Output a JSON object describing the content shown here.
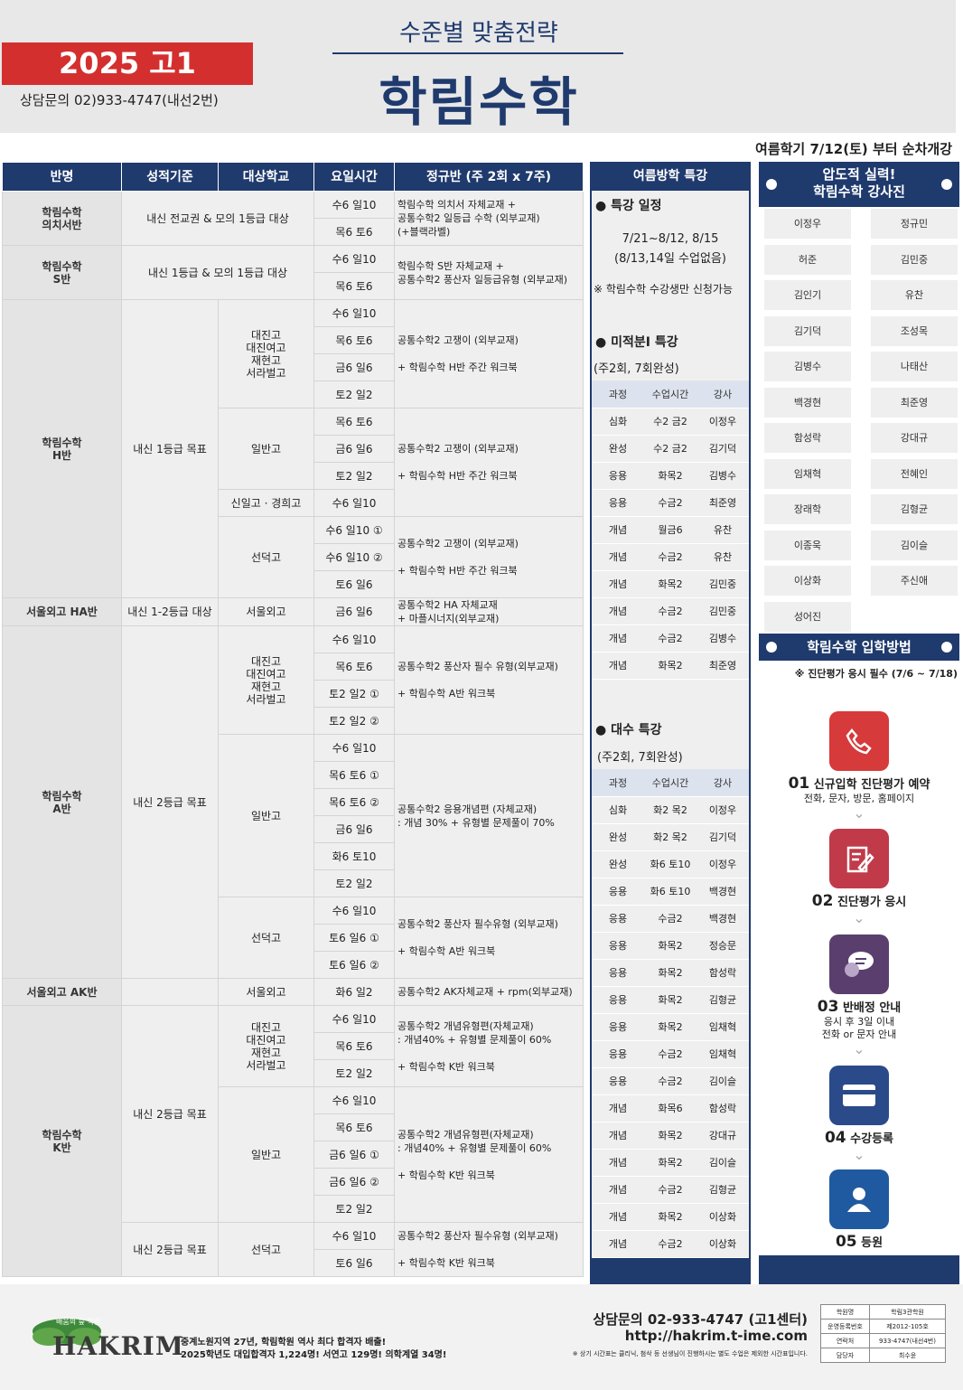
{
  "header": {
    "year": "2025 고1",
    "phone": "상담문의 02)933-4747(내선2번)",
    "subtitle": "수준별 맞춤전략",
    "title": "학림수학",
    "open": "여름학기 7/12(토) 부터 순차개강"
  },
  "cols": [
    "반명",
    "성적기준",
    "대상학교",
    "요일시간",
    "정규반 (주 2회 x 7주)"
  ],
  "rows": [
    [
      "학림수학\n의치서반",
      "내신 전교권 & 모의 1등급 대상",
      "",
      "수6 일10",
      "학림수학 의치서 자체교재 +\n공통수학2 일등급 수학 (외부교재)\n(+블랙라벨)"
    ],
    [
      "",
      "",
      "",
      "목6 토6",
      ""
    ],
    [
      "학림수학\nS반",
      "내신 1등급 & 모의 1등급 대상",
      "",
      "수6 일10",
      "학림수학 S반 자체교재 +\n공통수학2 풍산자 일등급유형 (외부교재)"
    ],
    [
      "",
      "",
      "",
      "목6 토6",
      ""
    ],
    [
      "학림수학\nH반",
      "내신 1등급 목표",
      "대진고\n대진여고\n재현고\n서라벌고",
      "수6 일10",
      "공통수학2 고쟁이 (외부교재)\n\n+ 학림수학 H반 주간 워크북"
    ],
    [
      "",
      "",
      "",
      "목6 토6",
      ""
    ],
    [
      "",
      "",
      "",
      "금6 일6",
      ""
    ],
    [
      "",
      "",
      "",
      "토2 일2",
      ""
    ],
    [
      "",
      "",
      "일반고",
      "목6 토6",
      "공통수학2 고쟁이 (외부교재)\n\n+ 학림수학 H반 주간 워크북"
    ],
    [
      "",
      "",
      "",
      "금6 일6",
      ""
    ],
    [
      "",
      "",
      "",
      "토2 일2",
      ""
    ],
    [
      "",
      "",
      "신일고 · 경희고",
      "수6 일10",
      ""
    ],
    [
      "",
      "",
      "선덕고",
      "수6 일10 ①",
      "공통수학2 고쟁이 (외부교재)\n\n+ 학림수학 H반 주간 워크북"
    ],
    [
      "",
      "",
      "",
      "수6 일10 ②",
      ""
    ],
    [
      "",
      "",
      "",
      "토6 일6",
      ""
    ],
    [
      "서울외고 HA반",
      "내신 1-2등급 대상",
      "서울외고",
      "금6 일6",
      "공통수학2 HA 자체교재\n+ 마플시너지(외부교재)"
    ],
    [
      "학림수학\nA반",
      "내신 2등급 목표",
      "대진고\n대진여고\n재현고\n서라벌고",
      "수6 일10",
      "공통수학2 풍산자 필수 유형(외부교재)\n\n+ 학림수학 A반 워크북"
    ],
    [
      "",
      "",
      "",
      "목6 토6",
      ""
    ],
    [
      "",
      "",
      "",
      "토2 일2 ①",
      ""
    ],
    [
      "",
      "",
      "",
      "토2 일2 ②",
      ""
    ],
    [
      "",
      "",
      "일반고",
      "수6 일10",
      "공통수학2 응용개념편 (자체교재)\n: 개념 30% + 유형별 문제풀이 70%"
    ],
    [
      "",
      "",
      "",
      "목6 토6 ①",
      ""
    ],
    [
      "",
      "",
      "",
      "목6 토6 ②",
      ""
    ],
    [
      "",
      "",
      "",
      "금6 일6",
      ""
    ],
    [
      "",
      "",
      "",
      "화6 토10",
      ""
    ],
    [
      "",
      "",
      "",
      "토2 일2",
      ""
    ],
    [
      "",
      "",
      "선덕고",
      "수6 일10",
      "공통수학2 풍산자 필수유형 (외부교재)\n\n+ 학림수학 A반 워크북"
    ],
    [
      "",
      "",
      "",
      "토6 일6 ①",
      ""
    ],
    [
      "",
      "",
      "",
      "토6 일6 ②",
      ""
    ],
    [
      "서울외고 AK반",
      "",
      "서울외고",
      "화6 일2",
      "공통수학2 AK자체교재 + rpm(외부교재)"
    ],
    [
      "학림수학\nK반",
      "내신 2등급 목표",
      "대진고\n대진여고\n재현고\n서라벌고",
      "수6 일10",
      "공통수학2 개념유형편(자체교재)\n: 개념40% + 유형별 문제풀이 60%\n\n+ 학림수학 K반 워크북"
    ],
    [
      "",
      "",
      "",
      "목6 토6",
      ""
    ],
    [
      "",
      "",
      "",
      "토2 일2",
      ""
    ],
    [
      "",
      "",
      "일반고",
      "수6 일10",
      "공통수학2 개념유형편(자체교재)\n: 개념40% + 유형별 문제풀이 60%\n\n+ 학림수학 K반 워크북"
    ],
    [
      "",
      "",
      "",
      "목6 토6",
      ""
    ],
    [
      "",
      "",
      "",
      "금6 일6 ①",
      ""
    ],
    [
      "",
      "",
      "",
      "금6 일6 ②",
      ""
    ],
    [
      "",
      "",
      "",
      "토2 일2",
      ""
    ],
    [
      "",
      "내신 2등급 목표",
      "선덕고",
      "수6 일10",
      "공통수학2 풍산자 필수유형 (외부교재)\n\n+ 학림수학 K반 워크북"
    ],
    [
      "",
      "",
      "",
      "토6 일6",
      ""
    ]
  ],
  "summer": {
    "head": "여름방학 특강",
    "s1": "● 특강 일정",
    "s1a": "7/21~8/12, 8/15",
    "s1b": "(8/13,14일 수업없음)",
    "s1c": "※ 학림수학 수강생만 신청가능",
    "s2": "● 미적분Ⅰ 특강",
    "s2a": "(주2회, 7회완성)",
    "cols": [
      "과정",
      "수업시간",
      "강사"
    ],
    "t1": [
      [
        "심화",
        "수2 금2",
        "이정우"
      ],
      [
        "완성",
        "수2 금2",
        "김기덕"
      ],
      [
        "응용",
        "화목2",
        "김병수"
      ],
      [
        "응용",
        "수금2",
        "최준영"
      ],
      [
        "개념",
        "월금6",
        "유찬"
      ],
      [
        "개념",
        "수금2",
        "유찬"
      ],
      [
        "개념",
        "화목2",
        "김민중"
      ],
      [
        "개념",
        "수금2",
        "김민중"
      ],
      [
        "개념",
        "수금2",
        "김병수"
      ],
      [
        "개념",
        "화목2",
        "최준영"
      ]
    ],
    "s3": "● 대수 특강",
    "s3a": "(주2회, 7회완성)",
    "t2": [
      [
        "심화",
        "화2 목2",
        "이정우"
      ],
      [
        "완성",
        "화2 목2",
        "김기덕"
      ],
      [
        "완성",
        "화6 토10",
        "이정우"
      ],
      [
        "응용",
        "화6 토10",
        "백경현"
      ],
      [
        "응용",
        "수금2",
        "백경현"
      ],
      [
        "응용",
        "화목2",
        "정승문"
      ],
      [
        "응용",
        "화목2",
        "함성락"
      ],
      [
        "응용",
        "화목2",
        "김형균"
      ],
      [
        "응용",
        "화목2",
        "임채혁"
      ],
      [
        "응용",
        "수금2",
        "임채혁"
      ],
      [
        "응용",
        "수금2",
        "김이슬"
      ],
      [
        "개념",
        "화목6",
        "함성락"
      ],
      [
        "개념",
        "화목2",
        "강대규"
      ],
      [
        "개념",
        "화목2",
        "김이슬"
      ],
      [
        "개념",
        "수금2",
        "김형균"
      ],
      [
        "개념",
        "화목2",
        "이상화"
      ],
      [
        "개념",
        "수금2",
        "이상화"
      ]
    ]
  },
  "staff": {
    "banner1": "압도적 실력!",
    "banner2": "학림수학 강사진",
    "names": [
      "이정우",
      "정규민",
      "허준",
      "김민중",
      "김인기",
      "유찬",
      "김기덕",
      "조성목",
      "김병수",
      "나태산",
      "백경현",
      "최준영",
      "함성락",
      "강대규",
      "임채혁",
      "전혜인",
      "장래학",
      "김형균",
      "이종욱",
      "김이슬",
      "이상화",
      "주신애",
      "성어진"
    ],
    "enroll": "학림수학 입학방법",
    "note": "※ 진단평가 응시 필수 (7/6 ~ 7/18)",
    "steps": [
      {
        "n": "01",
        "t": "신규입학 진단평가 예약",
        "d": "전화, 문자, 방문, 홈페이지",
        "c": "#d63a3a"
      },
      {
        "n": "02",
        "t": "진단평가 응시",
        "d": "",
        "c": "#c03a4a"
      },
      {
        "n": "03",
        "t": "반배정 안내",
        "d": "응시 후 3일 이내\n전화 or 문자 안내",
        "c": "#5a3f6e"
      },
      {
        "n": "04",
        "t": "수강등록",
        "d": "",
        "c": "#2a4a8a"
      },
      {
        "n": "05",
        "t": "등원",
        "d": "",
        "c": "#1f5aa0"
      }
    ]
  },
  "footer": {
    "logo": "HAKRIM",
    "logo_small": "배움의 숲 학림",
    "l1": "중계노원지역 27년, 학림학원 역사 최다 합격자 배출!",
    "l2": "2025학년도 대입합격자 1,224명! 서연고 129명! 의학계열 34명!",
    "c1": "상담문의 02-933-4747 (고1센터)",
    "c2": "http://hakrim.t-ime.com",
    "c3": "※ 상기 시간표는 클리닉, 첨삭 등 선생님이 진행하시는 별도 수업은 제외한 시간표입니다.",
    "info": [
      [
        "학원명",
        "학림3관학원"
      ],
      [
        "운영등록번호",
        "제2012-105호"
      ],
      [
        "연락처",
        "933-4747(내선4번)"
      ],
      [
        "담당자",
        "최수윤"
      ]
    ]
  }
}
